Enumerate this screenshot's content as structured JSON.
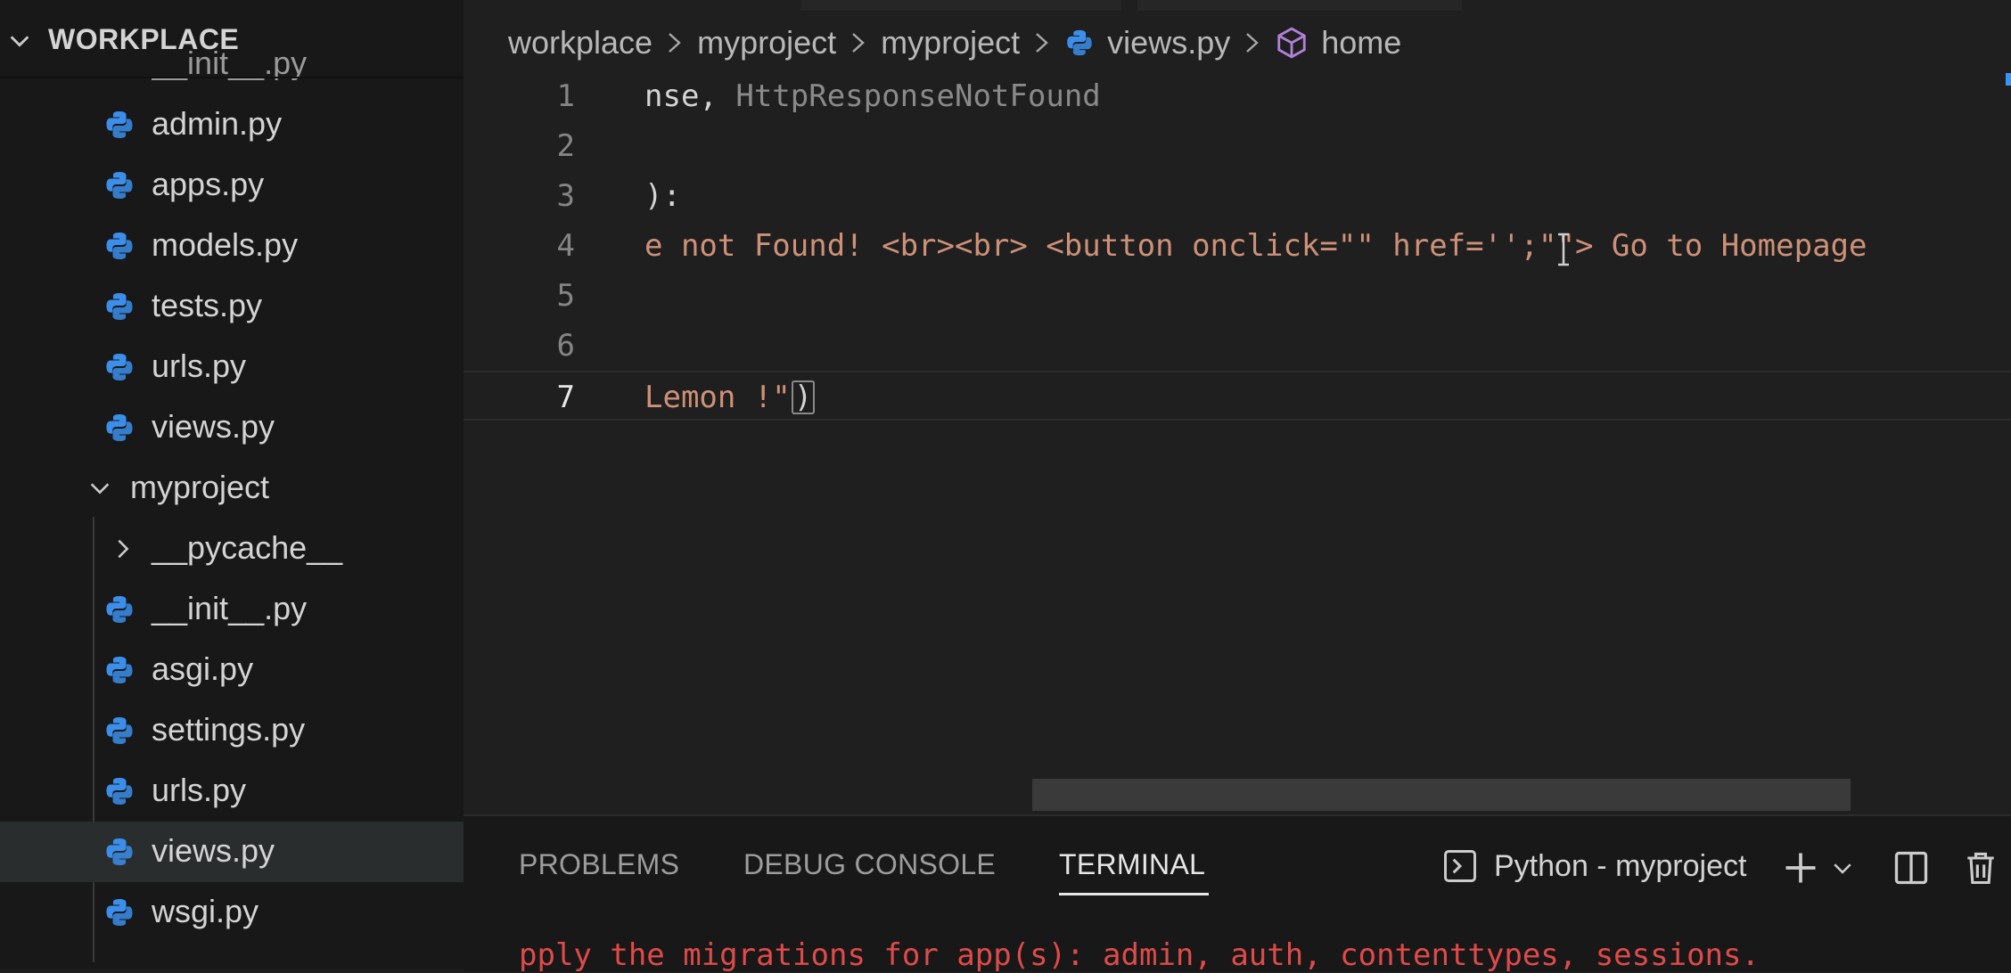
{
  "sidebar": {
    "title": "WORKPLACE",
    "cut_item": "__init__.py",
    "items": [
      {
        "label": "admin.py"
      },
      {
        "label": "apps.py"
      },
      {
        "label": "models.py"
      },
      {
        "label": "tests.py"
      },
      {
        "label": "urls.py"
      },
      {
        "label": "views.py"
      },
      {
        "label": "myproject"
      },
      {
        "label": "__pycache__"
      },
      {
        "label": "__init__.py"
      },
      {
        "label": "asgi.py"
      },
      {
        "label": "settings.py"
      },
      {
        "label": "urls.py"
      },
      {
        "label": "views.py"
      },
      {
        "label": "wsgi.py"
      }
    ]
  },
  "breadcrumb": {
    "items": [
      "workplace",
      "myproject",
      "myproject",
      "views.py",
      "home"
    ]
  },
  "editor": {
    "lines": [
      {
        "num": "1",
        "a": "nse, ",
        "b": "HttpResponseNotFound"
      },
      {
        "num": "2"
      },
      {
        "num": "3",
        "a": "):"
      },
      {
        "num": "4",
        "s": "e not Found! <br><br> <button onclick=\"\" href='';\"\"> Go to Homepage"
      },
      {
        "num": "5"
      },
      {
        "num": "6"
      },
      {
        "num": "7",
        "s": "Lemon !\"",
        "c": ")"
      }
    ]
  },
  "panel": {
    "tabs": [
      "PROBLEMS",
      "DEBUG CONSOLE",
      "TERMINAL"
    ],
    "terminal_name": "Python - myproject",
    "terminal_output": "pply the migrations for app(s): admin, auth, contenttypes, sessions."
  },
  "colors": {
    "string": "#ce9178",
    "error": "#e04a4a",
    "python_icon": "#3b8eea",
    "symbol_icon": "#b180d7"
  }
}
